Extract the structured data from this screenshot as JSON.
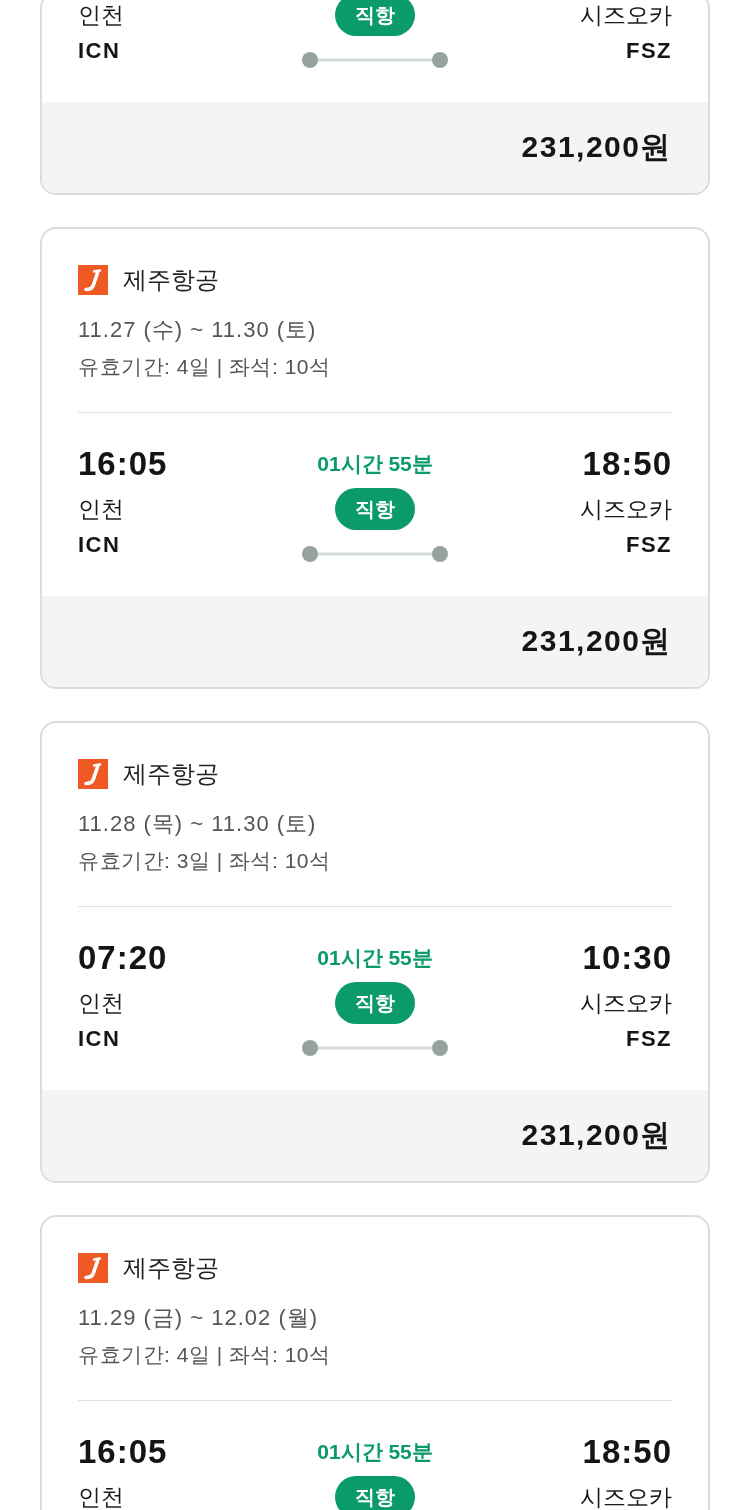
{
  "flights": [
    {
      "departure": {
        "city": "인천",
        "code": "ICN"
      },
      "stops": "직항",
      "arrival": {
        "city": "시즈오카",
        "code": "FSZ"
      },
      "price": "231,200원"
    },
    {
      "airline": "제주항공",
      "dates": "11.27 (수) ~ 11.30 (토)",
      "info": "유효기간: 4일 | 좌석: 10석",
      "departure": {
        "time": "16:05",
        "city": "인천",
        "code": "ICN"
      },
      "duration": "01시간 55분",
      "stops": "직항",
      "arrival": {
        "time": "18:50",
        "city": "시즈오카",
        "code": "FSZ"
      },
      "price": "231,200원"
    },
    {
      "airline": "제주항공",
      "dates": "11.28 (목) ~ 11.30 (토)",
      "info": "유효기간: 3일 | 좌석: 10석",
      "departure": {
        "time": "07:20",
        "city": "인천",
        "code": "ICN"
      },
      "duration": "01시간 55분",
      "stops": "직항",
      "arrival": {
        "time": "10:30",
        "city": "시즈오카",
        "code": "FSZ"
      },
      "price": "231,200원"
    },
    {
      "airline": "제주항공",
      "dates": "11.29 (금) ~ 12.02 (월)",
      "info": "유효기간: 4일 | 좌석: 10석",
      "departure": {
        "time": "16:05",
        "city": "인천"
      },
      "duration": "01시간 55분",
      "stops": "직항",
      "arrival": {
        "time": "18:50",
        "city": "시즈오카"
      }
    }
  ]
}
